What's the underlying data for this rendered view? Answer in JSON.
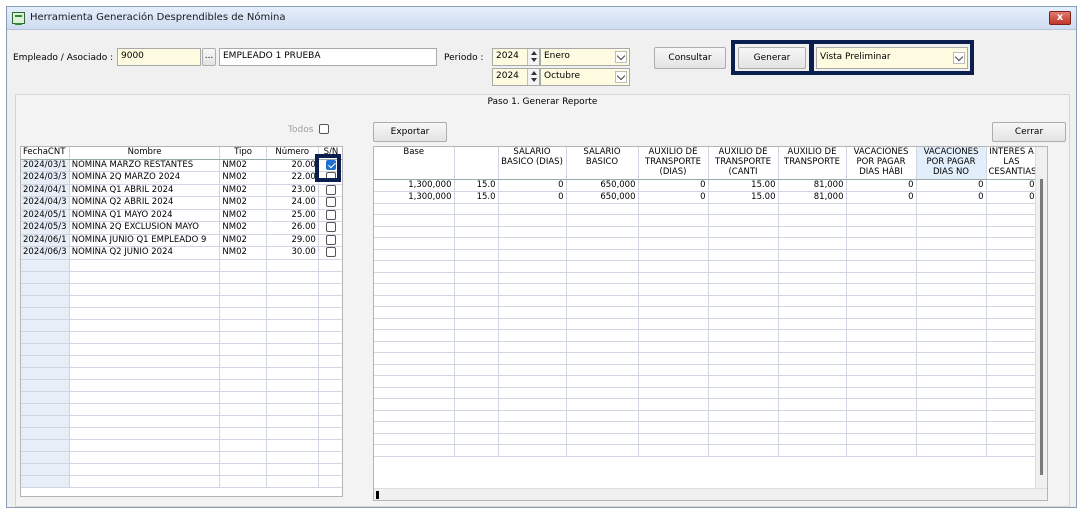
{
  "window": {
    "title": "Herramienta Generación Desprendibles de Nómina",
    "close_label": "x"
  },
  "empleado": {
    "label": "Empleado / Asociado :",
    "code": "9000",
    "browse_label": "...",
    "name": "EMPLEADO 1 PRUEBA"
  },
  "periodo": {
    "label": "Periodo :",
    "from_year": "2024",
    "from_month": "Enero",
    "to_year": "2024",
    "to_month": "Octubre"
  },
  "buttons": {
    "consultar": "Consultar",
    "generar": "Generar",
    "exportar": "Exportar",
    "cerrar": "Cerrar"
  },
  "report_type": {
    "selected": "Vista Preliminar"
  },
  "step_title": "Paso 1. Generar Reporte",
  "todos_label": "Todos",
  "left_table": {
    "headers": [
      "FechaCNT",
      "Nombre",
      "Tipo",
      "Número",
      "S/N"
    ],
    "rows": [
      {
        "fecha": "2024/03/1",
        "nombre": "NOMINA MARZO RESTANTES",
        "tipo": "NM02",
        "numero": "20.00",
        "checked": true
      },
      {
        "fecha": "2024/03/3",
        "nombre": "NOMINA 2Q MARZO 2024",
        "tipo": "NM02",
        "numero": "22.00",
        "checked": false
      },
      {
        "fecha": "2024/04/1",
        "nombre": "NOMINA Q1 ABRIL 2024",
        "tipo": "NM02",
        "numero": "23.00",
        "checked": false
      },
      {
        "fecha": "2024/04/3",
        "nombre": "NOMINA Q2 ABRIL 2024",
        "tipo": "NM02",
        "numero": "24.00",
        "checked": false
      },
      {
        "fecha": "2024/05/1",
        "nombre": "NOMINA Q1 MAYO 2024",
        "tipo": "NM02",
        "numero": "25.00",
        "checked": false
      },
      {
        "fecha": "2024/05/3",
        "nombre": "NOMINA 2Q EXCLUSION MAYO",
        "tipo": "NM02",
        "numero": "26.00",
        "checked": false
      },
      {
        "fecha": "2024/06/1",
        "nombre": "NOMINA JUNIO Q1 EMPLEADO 9",
        "tipo": "NM02",
        "numero": "29.00",
        "checked": false
      },
      {
        "fecha": "2024/06/3",
        "nombre": "NOMINA Q2 JUNIO 2024",
        "tipo": "NM02",
        "numero": "30.00",
        "checked": false
      }
    ]
  },
  "right_table": {
    "headers": [
      "Base",
      "",
      "SALARIO BASICO (DIAS)",
      "SALARIO BASICO",
      "AUXILIO DE TRANSPORTE (DIAS)",
      "AUXILIO DE TRANSPORTE (CANTI",
      "AUXILIO DE TRANSPORTE",
      "VACACIONES POR PAGAR DIAS HÁBI",
      "VACACIONES POR PAGAR DIAS NO",
      "INTERES A LAS CESANTIAS"
    ],
    "rows": [
      [
        "1,300,000",
        "15.0",
        "0",
        "650,000",
        "0",
        "15.00",
        "81,000",
        "0",
        "0",
        "0"
      ],
      [
        "1,300,000",
        "15.0",
        "0",
        "650,000",
        "0",
        "15.00",
        "81,000",
        "0",
        "0",
        "0"
      ]
    ]
  }
}
